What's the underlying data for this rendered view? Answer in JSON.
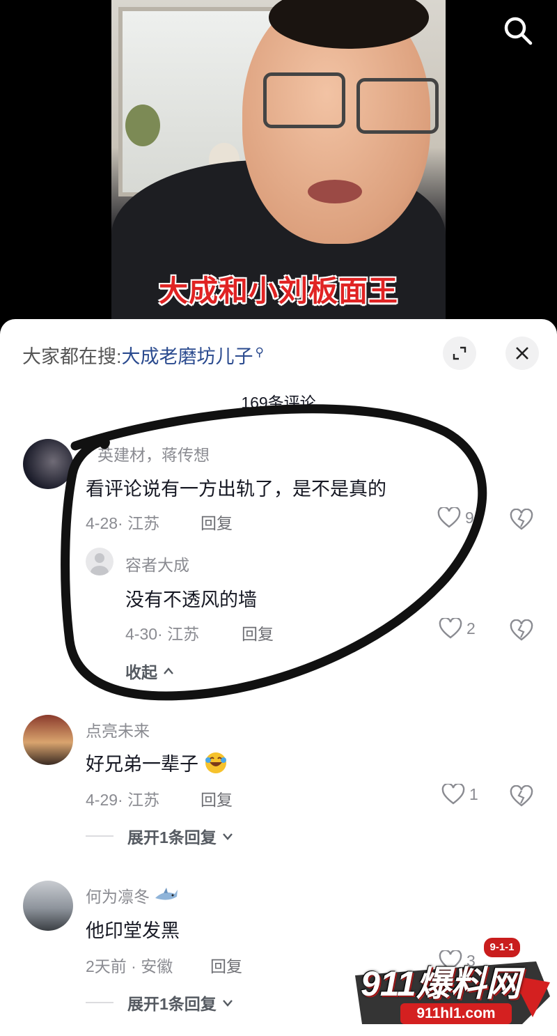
{
  "video": {
    "caption": "大成和小刘板面王"
  },
  "sheet": {
    "search_prefix": "大家都在搜:",
    "search_keyword": "大成老磨坊儿子",
    "comment_count": "169条评论"
  },
  "comments": [
    {
      "username": "英建材，蒋传想",
      "text": "看评论说有一方出轨了，是不是真的",
      "meta": "4-28· 江苏",
      "reply_label": "回复",
      "likes": "9",
      "replies": [
        {
          "username": "容者大成",
          "text": "没有不透风的墙",
          "meta": "4-30· 江苏",
          "reply_label": "回复",
          "likes": "2"
        }
      ],
      "toggle": "收起"
    },
    {
      "username": "点亮未来",
      "text": "好兄弟一辈子",
      "meta": "4-29· 江苏",
      "reply_label": "回复",
      "likes": "1",
      "toggle": "展开1条回复"
    },
    {
      "username": "何为凛冬",
      "text": "他印堂发黑",
      "meta": "2天前 · 安徽",
      "reply_label": "回复",
      "likes": "3",
      "toggle": "展开1条回复"
    }
  ],
  "watermark": {
    "badge": "9-1-1",
    "brand": "911爆料网",
    "url": "911hl1.com"
  },
  "colors": {
    "caption": "#e02323",
    "keyword": "#2b4b8f",
    "watermark": "#d42020"
  }
}
